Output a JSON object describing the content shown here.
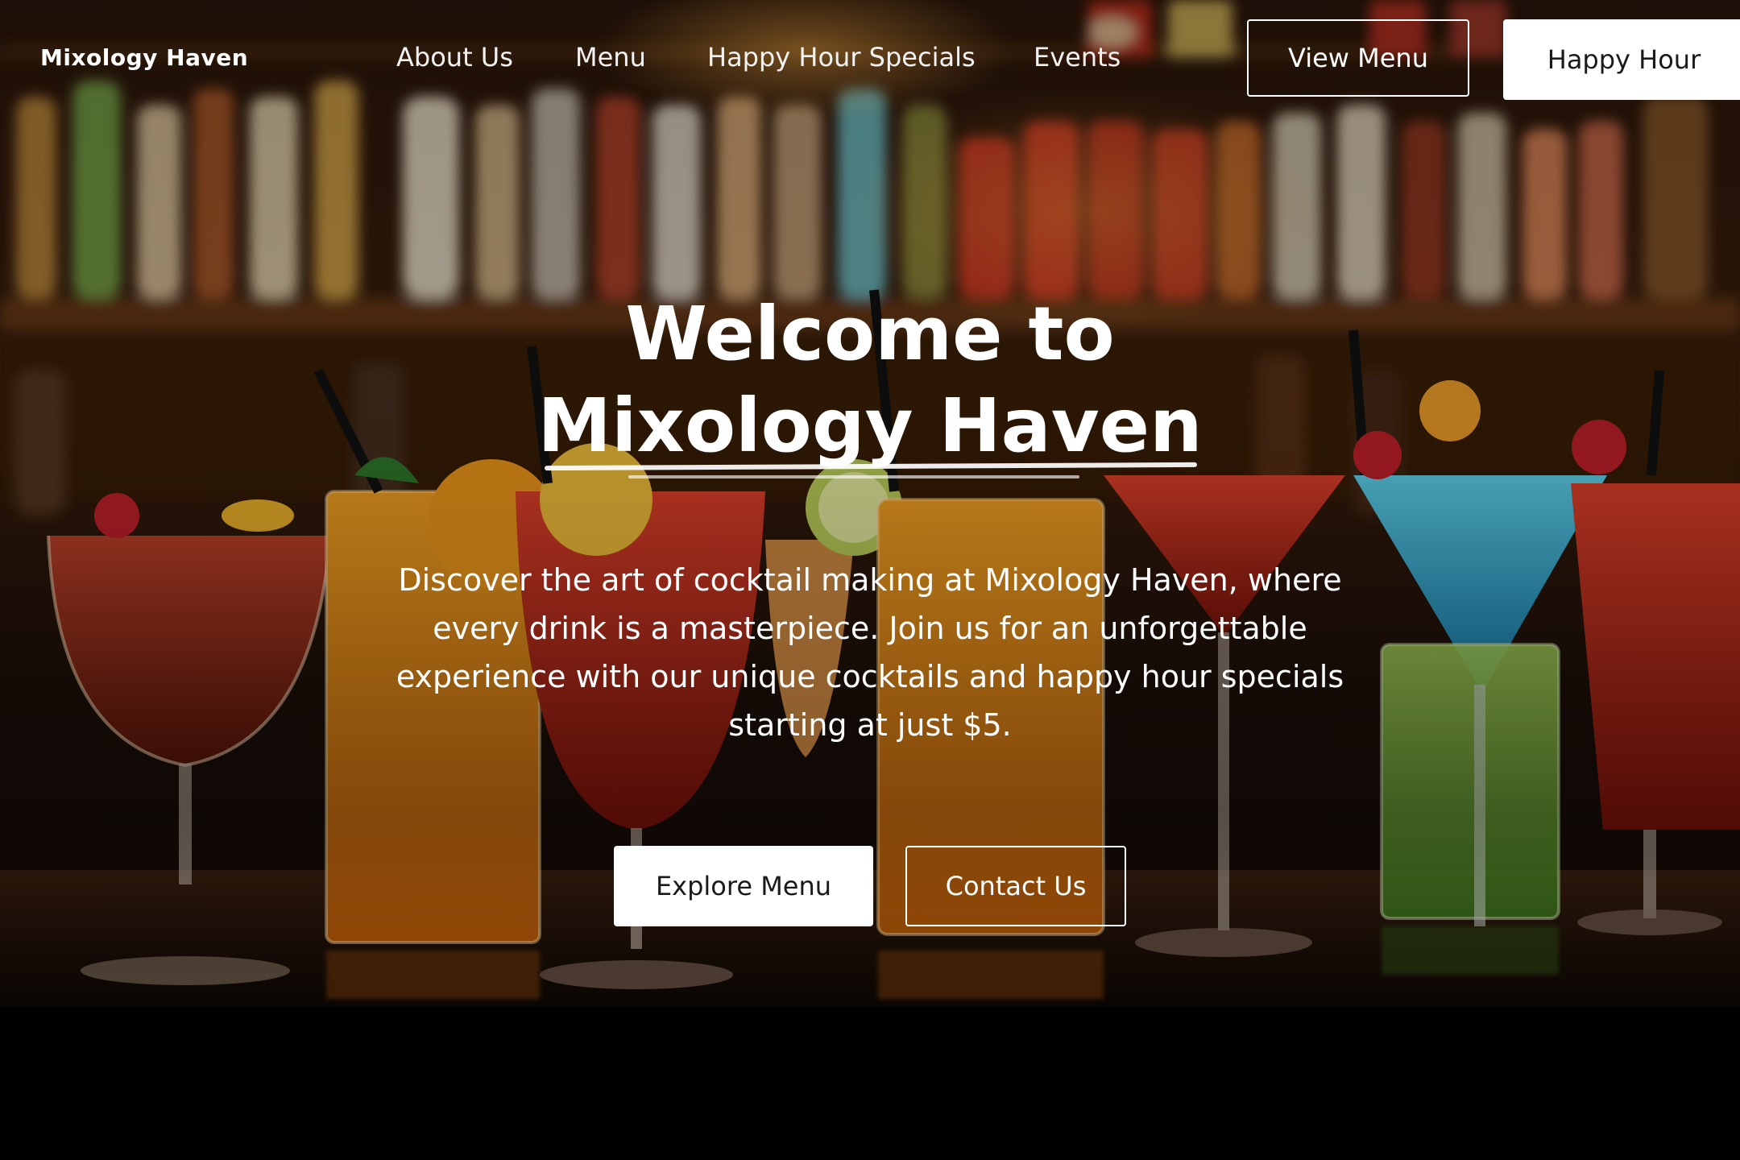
{
  "brand": {
    "name": "Mixology Haven"
  },
  "nav": {
    "links": [
      "About Us",
      "Menu",
      "Happy Hour Specials",
      "Events"
    ],
    "view_menu_label": "View Menu",
    "happy_hour_label": "Happy Hour"
  },
  "hero": {
    "title_line1": "Welcome to",
    "title_line2": "Mixology Haven",
    "description": "Discover the art of cocktail making at Mixology Haven, where every drink is a masterpiece. Join us for an unforgettable experience with our unique cocktails and happy hour specials starting at just $5.",
    "primary_cta": "Explore Menu",
    "secondary_cta": "Contact Us"
  },
  "colors": {
    "text": "#ffffff",
    "button_bg": "#ffffff",
    "button_text": "#1a1a1a",
    "footer_band": "#000000"
  }
}
